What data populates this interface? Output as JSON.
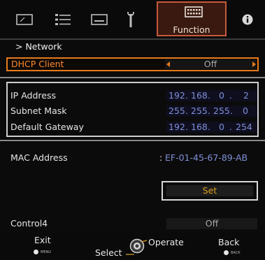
{
  "tabs": [
    {
      "icon": "picture-icon"
    },
    {
      "icon": "adjust-icon"
    },
    {
      "icon": "screen-icon"
    },
    {
      "icon": "installation-icon"
    },
    {
      "icon": "function-icon",
      "label": "Function",
      "active": true
    },
    {
      "icon": "info-icon"
    }
  ],
  "breadcrumb": ">  Network",
  "dhcp": {
    "label": "DHCP Client",
    "value": "Off"
  },
  "ip_address": {
    "label": "IP Address",
    "octets": [
      "192",
      "168",
      "0",
      "2"
    ]
  },
  "subnet_mask": {
    "label": "Subnet Mask",
    "octets": [
      "255",
      "255",
      "255",
      "0"
    ]
  },
  "default_gateway": {
    "label": "Default Gateway",
    "octets": [
      "192",
      "168",
      "0",
      "254"
    ]
  },
  "mac": {
    "label": "MAC Address",
    "colon": ":",
    "value": "EF-01-45-67-89-AB"
  },
  "set_button": {
    "label": "Set"
  },
  "control4": {
    "label": "Control4",
    "value": "Off"
  },
  "footer": {
    "exit": "Exit",
    "exit_sub": "MENU",
    "select": "Select",
    "operate": "Operate",
    "back": "Back",
    "back_sub": "BACK"
  },
  "colors": {
    "accent": "#e87a1a",
    "value_blue": "#7f8fd8",
    "set_text": "#e0a020",
    "active_tab_border": "#c45a3c"
  }
}
